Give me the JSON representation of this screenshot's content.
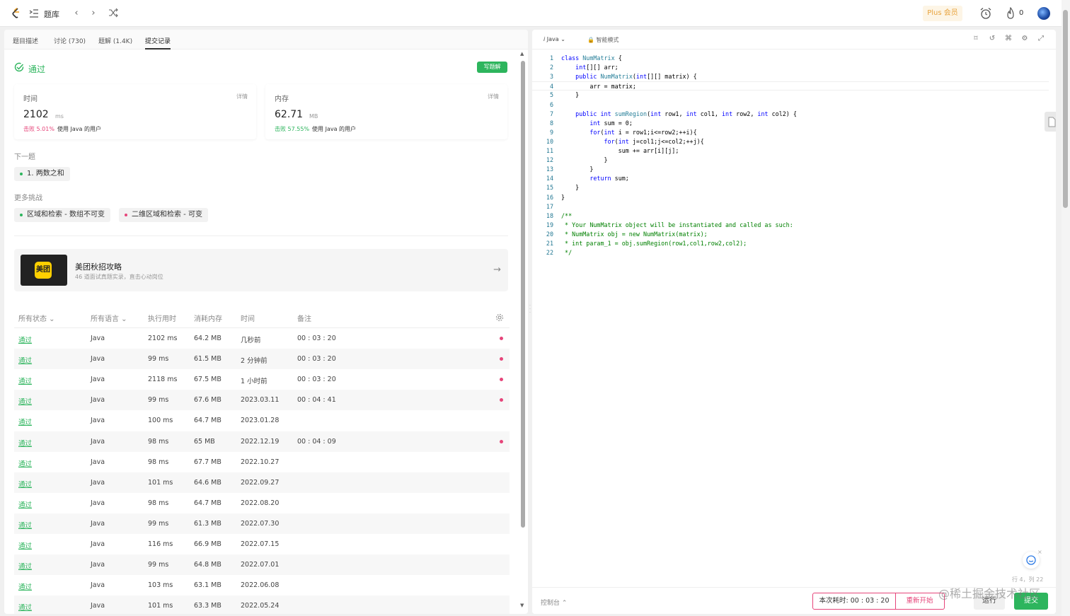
{
  "nav": {
    "title": "题库",
    "plus_label": "Plus 会员",
    "fire_count": "0"
  },
  "left": {
    "tabs": [
      "题目描述",
      "讨论 (730)",
      "题解 (1.4K)",
      "提交记录"
    ],
    "status": "通过",
    "write_solution": "写题解",
    "time_card": {
      "label": "时间",
      "detail": "详情",
      "value": "2102",
      "unit": "ms",
      "beat_pct": "击败 5.01%",
      "beat_desc": "使用 Java 的用户"
    },
    "memory_card": {
      "label": "内存",
      "detail": "详情",
      "value": "62.71",
      "unit": "MB",
      "beat_pct": "击败 57.55%",
      "beat_desc": "使用 Java 的用户"
    },
    "next_label": "下一题",
    "next_item": "1. 两数之和",
    "more_label": "更多挑战",
    "more_items": [
      "区域和检索 - 数组不可变",
      "二维区域和检索 - 可变"
    ],
    "promo": {
      "logo_text": "美团",
      "title": "美团秋招攻略",
      "subtitle": "46 道面试真题实录，直击心动岗位"
    },
    "table_headers": [
      "所有状态",
      "所有语言",
      "执行用时",
      "消耗内存",
      "时间",
      "备注"
    ],
    "rows": [
      {
        "status": "通过",
        "lang": "Java",
        "runtime": "2102 ms",
        "memory": "64.2 MB",
        "time": "几秒前",
        "note": "00 : 03 : 20"
      },
      {
        "status": "通过",
        "lang": "Java",
        "runtime": "99 ms",
        "memory": "61.5 MB",
        "time": "2 分钟前",
        "note": "00 : 03 : 20"
      },
      {
        "status": "通过",
        "lang": "Java",
        "runtime": "2118 ms",
        "memory": "67.5 MB",
        "time": "1 小时前",
        "note": "00 : 03 : 20"
      },
      {
        "status": "通过",
        "lang": "Java",
        "runtime": "99 ms",
        "memory": "67.6 MB",
        "time": "2023.03.11",
        "note": "00 : 04 : 41"
      },
      {
        "status": "通过",
        "lang": "Java",
        "runtime": "100 ms",
        "memory": "64.7 MB",
        "time": "2023.01.28",
        "note": ""
      },
      {
        "status": "通过",
        "lang": "Java",
        "runtime": "98 ms",
        "memory": "65 MB",
        "time": "2022.12.19",
        "note": "00 : 04 : 09"
      },
      {
        "status": "通过",
        "lang": "Java",
        "runtime": "98 ms",
        "memory": "67.7 MB",
        "time": "2022.10.27",
        "note": ""
      },
      {
        "status": "通过",
        "lang": "Java",
        "runtime": "101 ms",
        "memory": "64.6 MB",
        "time": "2022.09.27",
        "note": ""
      },
      {
        "status": "通过",
        "lang": "Java",
        "runtime": "98 ms",
        "memory": "64.7 MB",
        "time": "2022.08.20",
        "note": ""
      },
      {
        "status": "通过",
        "lang": "Java",
        "runtime": "99 ms",
        "memory": "61.3 MB",
        "time": "2022.07.30",
        "note": ""
      },
      {
        "status": "通过",
        "lang": "Java",
        "runtime": "116 ms",
        "memory": "66.9 MB",
        "time": "2022.07.15",
        "note": ""
      },
      {
        "status": "通过",
        "lang": "Java",
        "runtime": "99 ms",
        "memory": "64.8 MB",
        "time": "2022.07.01",
        "note": ""
      },
      {
        "status": "通过",
        "lang": "Java",
        "runtime": "103 ms",
        "memory": "63.1 MB",
        "time": "2022.06.08",
        "note": ""
      },
      {
        "status": "通过",
        "lang": "Java",
        "runtime": "101 ms",
        "memory": "63.3 MB",
        "time": "2022.05.24",
        "note": ""
      }
    ],
    "row_dots": [
      true,
      true,
      true,
      true,
      false,
      true,
      false,
      false,
      false,
      false,
      false,
      false,
      false,
      false
    ]
  },
  "right": {
    "language": "Java",
    "mode": "智能模式",
    "code_lines": [
      "class NumMatrix {",
      "    int[][] arr;",
      "    public NumMatrix(int[][] matrix) {",
      "        arr = matrix;",
      "    }",
      "",
      "    public int sumRegion(int row1, int col1, int row2, int col2) {",
      "        int sum = 0;",
      "        for(int i = row1;i<=row2;++i){",
      "            for(int j=col1;j<=col2;++j){",
      "                sum += arr[i][j];",
      "            }",
      "        }",
      "        return sum;",
      "    }",
      "}",
      "",
      "/**",
      " * Your NumMatrix object will be instantiated and called as such:",
      " * NumMatrix obj = new NumMatrix(matrix);",
      " * int param_1 = obj.sumRegion(row1,col1,row2,col2);",
      " */"
    ],
    "cursor_pos": "行 4，列 22",
    "console_label": "控制台",
    "timer": "本次耗时: 00 : 03 : 20",
    "restart": "重新开始",
    "run": "运行",
    "submit": "提交"
  },
  "watermark": "@稀土掘金技术社区",
  "colors": {
    "green": "#2db55d",
    "pink": "#e6457a",
    "gold": "#e8a33d"
  }
}
